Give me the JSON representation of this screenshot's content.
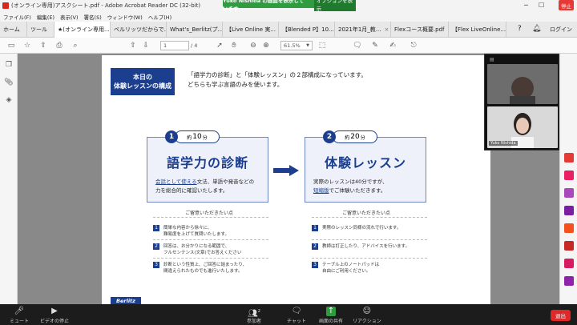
{
  "window": {
    "title": "(オンライン専用)アスクシート.pdf - Adobe Acrobat Reader DC (32-bit)",
    "share_banner": "Yuko Nishida の画面を表示しています",
    "view_options": "オプションを表示",
    "stop_share": "停止"
  },
  "menu": [
    "ファイル(F)",
    "編集(E)",
    "表示(V)",
    "署名(S)",
    "ウィンドウ(W)",
    "ヘルプ(H)"
  ],
  "tabs": [
    {
      "label": "ホーム"
    },
    {
      "label": "ツール"
    },
    {
      "label": "★(オンライン専用..."
    },
    {
      "label": "ベルリッツだからで..."
    },
    {
      "label": "What's_Berlitz(プ..."
    },
    {
      "label": "【Live Online 実..."
    },
    {
      "label": "【Blended P】10..."
    },
    {
      "label": "2021年1月_教..."
    },
    {
      "label": "Flexコース概要.pdf"
    },
    {
      "label": "【Flex LiveOnline..."
    }
  ],
  "account": {
    "login": "ログイン"
  },
  "toolbar": {
    "page_current": "1",
    "page_total": "/ 4",
    "zoom": "61.5%"
  },
  "document": {
    "intro_label_line1": "本日の",
    "intro_label_line2": "体験レッスンの構成",
    "intro_line1": "「語学力の診断」と「体験レッスン」の２部構成になっています。",
    "intro_line2": "どちらも学ぶ言語のみを使います。",
    "card1": {
      "number": "1",
      "duration_prefix": "約",
      "duration": "10",
      "duration_unit": "分",
      "heading": "語学力の診断",
      "body_hl": "会話として使える",
      "body_rest": "文法、単語や発音などの",
      "body_line2": "力を総合的に確認いたします。"
    },
    "card2": {
      "number": "2",
      "duration_prefix": "約",
      "duration": "20",
      "duration_unit": "分",
      "heading": "体験レッスン",
      "body_line1": "実際のレッスンは40分ですが、",
      "body_hl": "短縮版",
      "body_rest": "でご体験いただきます。"
    },
    "notes_title_left": "ご留意いただきたい点",
    "notes_title_right": "ご留意いただきたい点",
    "notes_left": [
      {
        "n": "1",
        "line1": "簡単な内容から徐々に、",
        "line2": "難易度を上げて質問いたします。"
      },
      {
        "n": "2",
        "line1": "回答は、お分かりになる範囲で、",
        "line2": "フルセンテンス(文章)でお答えください"
      },
      {
        "n": "3",
        "line1": "診断という性質上、ご回答に詰まったり、",
        "line2": "間違えられたものでも進行いたします。"
      }
    ],
    "notes_right": [
      {
        "n": "1",
        "line1": "実際のレッスン同様の流れで行います。",
        "line2": ""
      },
      {
        "n": "2",
        "line1": "教師は訂正したり、アドバイスを行います。",
        "line2": ""
      },
      {
        "n": "3",
        "line1": "テーブル上のノートパッドは",
        "line2": "自由にご利用ください。"
      }
    ],
    "brand": "Berlitz"
  },
  "video": {
    "participant_name": "Yuko Nishida"
  },
  "zoom_bar": {
    "mute": "ミュート",
    "video_stop": "ビデオの停止",
    "participants": "参加者",
    "participants_count": "2",
    "chat": "チャット",
    "share_screen": "画面の共有",
    "reactions": "リアクション",
    "end": "退出"
  },
  "colors": {
    "accent_navy": "#1c3e8e",
    "share_green": "#2f9c3f",
    "end_red": "#e02828"
  }
}
